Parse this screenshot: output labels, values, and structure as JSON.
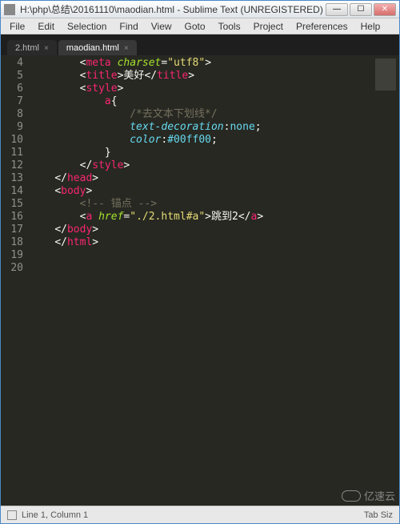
{
  "window": {
    "title": "H:\\php\\总结\\20161110\\maodian.html - Sublime Text (UNREGISTERED)"
  },
  "menu": {
    "items": [
      "File",
      "Edit",
      "Selection",
      "Find",
      "View",
      "Goto",
      "Tools",
      "Project",
      "Preferences",
      "Help"
    ]
  },
  "tabs": [
    {
      "label": "2.html",
      "active": false
    },
    {
      "label": "maodian.html",
      "active": true
    }
  ],
  "gutter": {
    "start": 4,
    "end": 20
  },
  "code": {
    "lines": [
      {
        "indent": 8,
        "parts": [
          [
            "punct",
            "<"
          ],
          [
            "tag",
            "meta"
          ],
          [
            "punct",
            " "
          ],
          [
            "attr",
            "charset"
          ],
          [
            "punct",
            "="
          ],
          [
            "str",
            "\"utf8\""
          ],
          [
            "punct",
            ">"
          ]
        ]
      },
      {
        "indent": 8,
        "parts": [
          [
            "punct",
            "<"
          ],
          [
            "tag",
            "title"
          ],
          [
            "punct",
            ">"
          ],
          [
            "txt",
            "美好"
          ],
          [
            "punct",
            "</"
          ],
          [
            "tag",
            "title"
          ],
          [
            "punct",
            ">"
          ]
        ]
      },
      {
        "indent": 8,
        "parts": [
          [
            "punct",
            "<"
          ],
          [
            "tag",
            "style"
          ],
          [
            "punct",
            ">"
          ]
        ]
      },
      {
        "indent": 12,
        "parts": [
          [
            "kw",
            "a"
          ],
          [
            "punct",
            "{"
          ]
        ]
      },
      {
        "indent": 16,
        "parts": [
          [
            "comment",
            "/*去文本下划线*/"
          ]
        ]
      },
      {
        "indent": 16,
        "parts": [
          [
            "prop",
            "text-decoration"
          ],
          [
            "punct",
            ":"
          ],
          [
            "val",
            "none"
          ],
          [
            "punct",
            ";"
          ]
        ]
      },
      {
        "indent": 16,
        "parts": [
          [
            "prop",
            "color"
          ],
          [
            "punct",
            ":"
          ],
          [
            "val",
            "#00ff00"
          ],
          [
            "punct",
            ";"
          ]
        ]
      },
      {
        "indent": 12,
        "parts": [
          [
            "punct",
            "}"
          ]
        ]
      },
      {
        "indent": 8,
        "parts": [
          [
            "punct",
            "</"
          ],
          [
            "tag",
            "style"
          ],
          [
            "punct",
            ">"
          ]
        ]
      },
      {
        "indent": 4,
        "parts": [
          [
            "punct",
            "</"
          ],
          [
            "tag",
            "head"
          ],
          [
            "punct",
            ">"
          ]
        ]
      },
      {
        "indent": 4,
        "parts": [
          [
            "punct",
            "<"
          ],
          [
            "tag",
            "body"
          ],
          [
            "punct",
            ">"
          ]
        ]
      },
      {
        "indent": 8,
        "parts": [
          [
            "comment",
            "<!-- 锚点 -->"
          ]
        ]
      },
      {
        "indent": 8,
        "parts": [
          [
            "punct",
            "<"
          ],
          [
            "tag",
            "a"
          ],
          [
            "punct",
            " "
          ],
          [
            "attr",
            "href"
          ],
          [
            "punct",
            "="
          ],
          [
            "str",
            "\"./2.html#a\""
          ],
          [
            "punct",
            ">"
          ],
          [
            "txt",
            "跳到2"
          ],
          [
            "punct",
            "</"
          ],
          [
            "tag",
            "a"
          ],
          [
            "punct",
            ">"
          ]
        ]
      },
      {
        "indent": 4,
        "parts": [
          [
            "punct",
            "</"
          ],
          [
            "tag",
            "body"
          ],
          [
            "punct",
            ">"
          ]
        ]
      },
      {
        "indent": 4,
        "parts": [
          [
            "punct",
            "</"
          ],
          [
            "tag",
            "html"
          ],
          [
            "punct",
            ">"
          ]
        ]
      },
      {
        "indent": 0,
        "parts": []
      },
      {
        "indent": 0,
        "parts": []
      }
    ]
  },
  "status": {
    "left": "Line 1, Column 1",
    "right": "Tab Siz"
  },
  "watermark": "亿速云"
}
